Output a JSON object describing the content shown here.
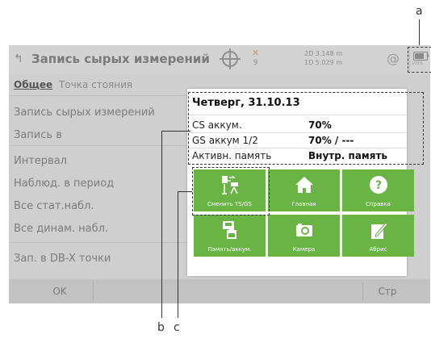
{
  "callouts": {
    "a": "a",
    "b": "b",
    "c": "c"
  },
  "header": {
    "title": "Запись сырых измерений",
    "satellites": "9",
    "quality_2d": "2D 3.148 m",
    "quality_1d": "1D 5.029 m",
    "at_symbol": "@",
    "battery_label": "100%"
  },
  "tabs": {
    "active": "Общее",
    "other": "Точка стояния"
  },
  "fields": [
    "Запись сырых измерений",
    "Запись в",
    "Интервал",
    "Наблюд. в период",
    "Все стат.набл.",
    "Все динам. набл.",
    "Зап. в DB-X точки"
  ],
  "bottom": {
    "ok": "OK",
    "page": "Стр"
  },
  "popup": {
    "date": "Четверг, 31.10.13",
    "rows": [
      {
        "label": "CS аккум.",
        "value": "70%"
      },
      {
        "label": "GS аккум 1/2",
        "value": "70% / ---"
      },
      {
        "label": "Активн. память",
        "value": "Внутр. память"
      }
    ],
    "tiles": [
      {
        "label": "Сменить TS/GS",
        "icon": "switch-ts-gs-icon"
      },
      {
        "label": "Главная",
        "icon": "home-icon"
      },
      {
        "label": "Справка",
        "icon": "help-icon"
      },
      {
        "label": "Память/аккум.",
        "icon": "memory-battery-icon"
      },
      {
        "label": "Камера",
        "icon": "camera-icon"
      },
      {
        "label": "Абрис",
        "icon": "sketch-icon"
      }
    ]
  },
  "colors": {
    "tile": "#6ab446",
    "overlay": "#cfcfcf"
  }
}
